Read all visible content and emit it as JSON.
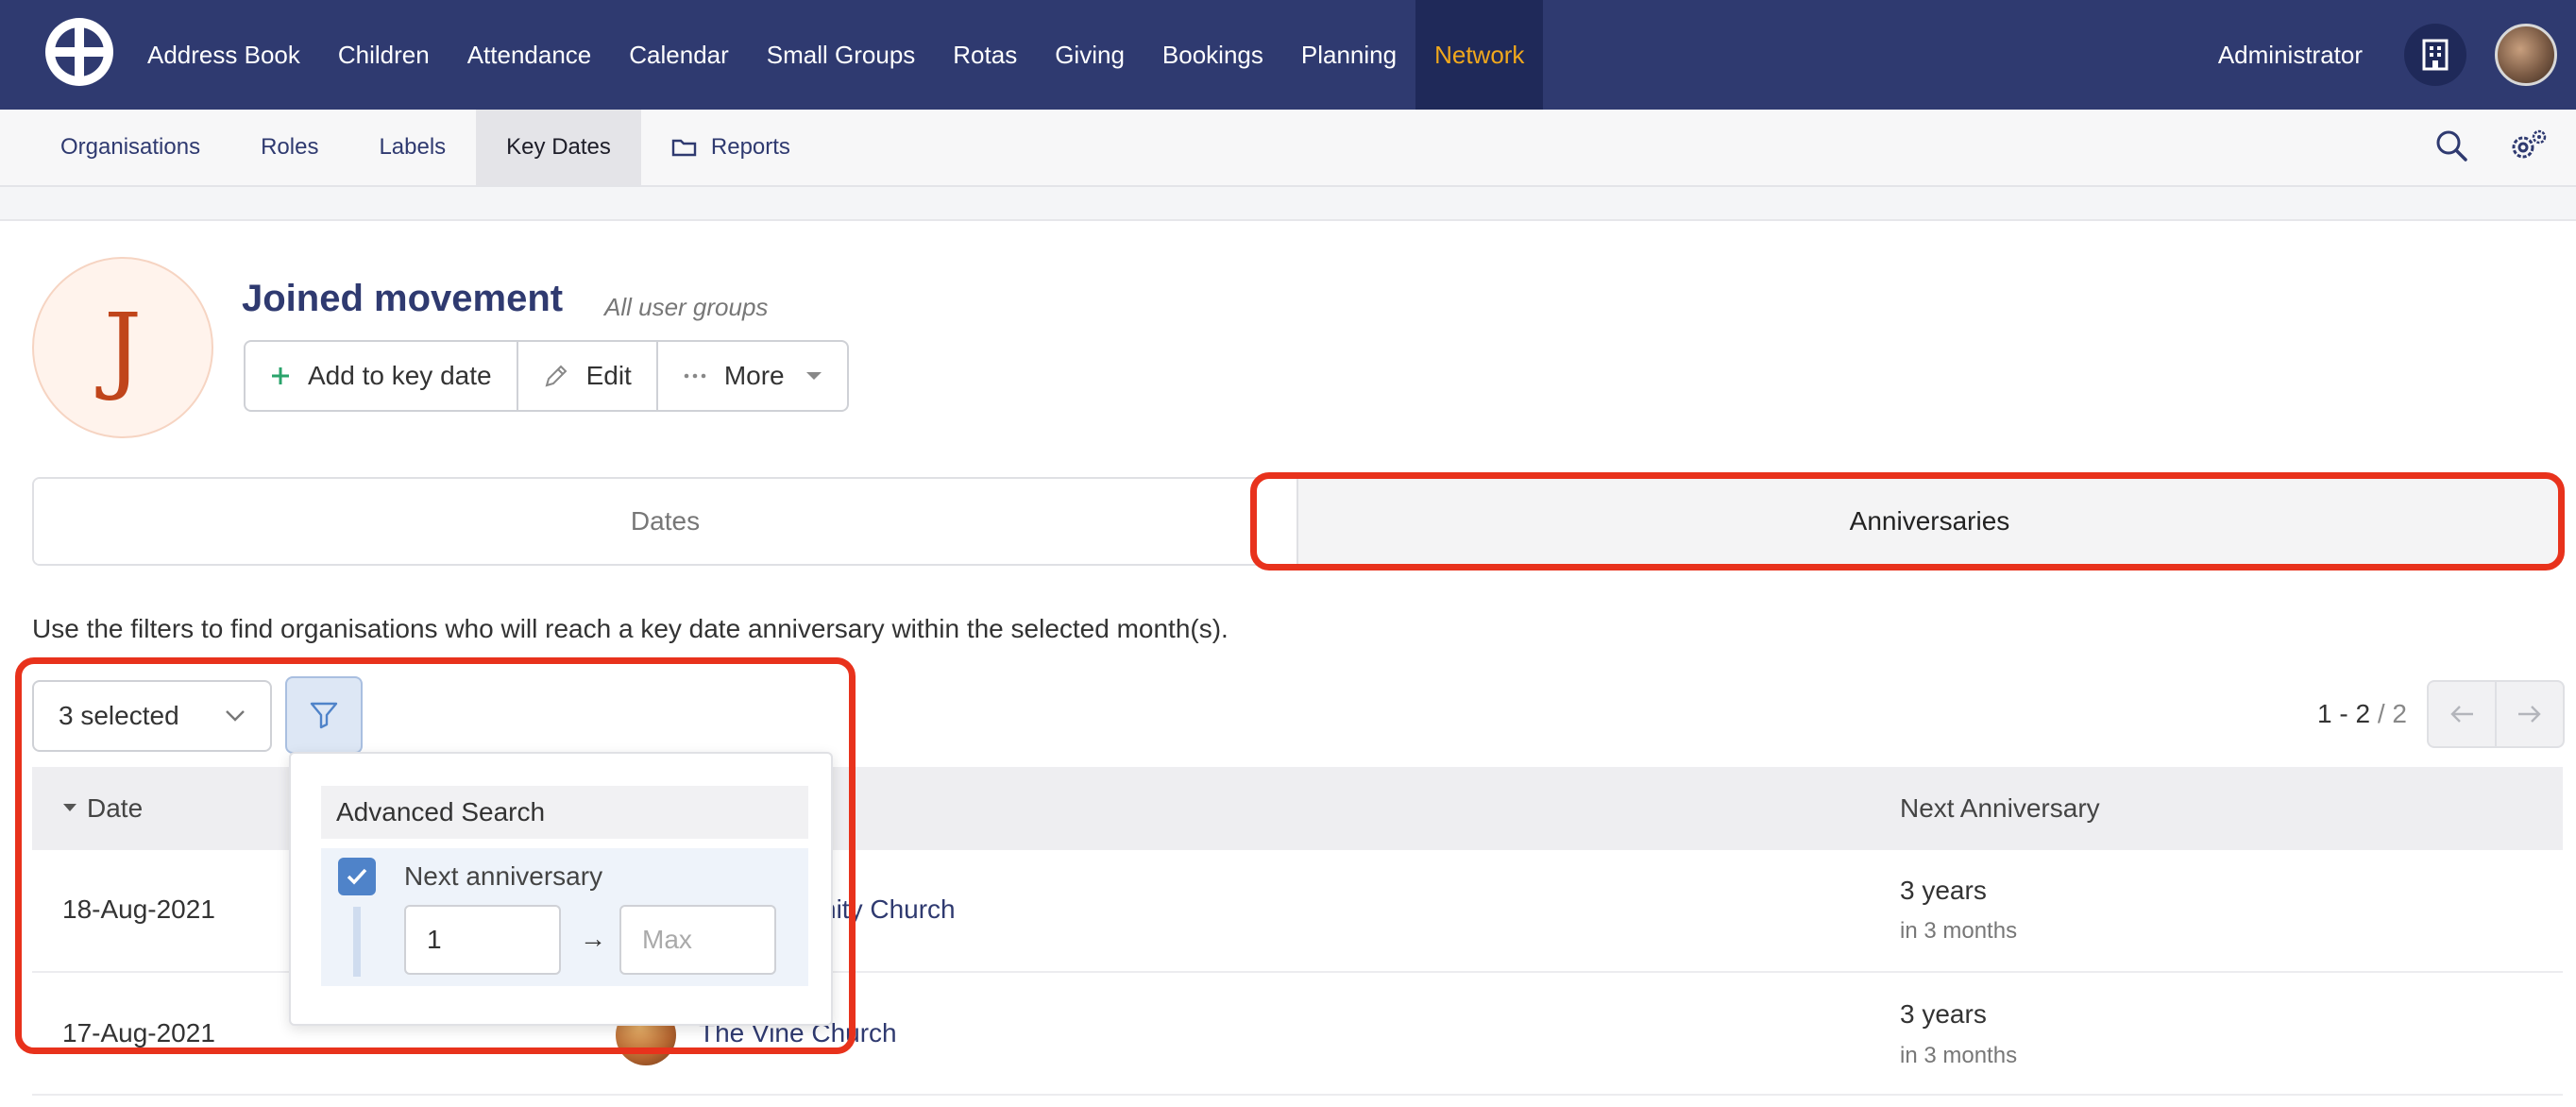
{
  "topnav": {
    "items": [
      "Address Book",
      "Children",
      "Attendance",
      "Calendar",
      "Small Groups",
      "Rotas",
      "Giving",
      "Bookings",
      "Planning",
      "Network"
    ],
    "active": "Network",
    "user_label": "Administrator"
  },
  "subnav": {
    "items": [
      "Organisations",
      "Roles",
      "Labels",
      "Key Dates",
      "Reports"
    ],
    "active": "Key Dates"
  },
  "keydate": {
    "avatar_letter": "J",
    "title": "Joined movement",
    "subtitle": "All user groups",
    "buttons": {
      "add": "Add to key date",
      "edit": "Edit",
      "more": "More"
    }
  },
  "tabs": {
    "dates": "Dates",
    "anniversaries": "Anniversaries",
    "active": "Anniversaries"
  },
  "hint": "Use the filters to find organisations who will reach a key date anniversary within the selected month(s).",
  "filter": {
    "select_value": "3 selected"
  },
  "pager": {
    "range": "1 - 2",
    "total": "/ 2"
  },
  "table": {
    "headers": {
      "date": "Date",
      "next": "Next Anniversary"
    },
    "rows": [
      {
        "date": "18-Aug-2021",
        "name": "Community Church",
        "years": "3 years",
        "when": "in 3 months"
      },
      {
        "date": "17-Aug-2021",
        "name": "The Vine Church",
        "years": "3 years",
        "when": "in 3 months"
      }
    ]
  },
  "advanced_search": {
    "title": "Advanced Search",
    "checkbox_label": "Next anniversary",
    "checked": true,
    "min_value": "1",
    "max_placeholder": "Max",
    "arrow": "→"
  },
  "colors": {
    "nav_bg": "#2f3a70",
    "active_nav_text": "#f1a81c",
    "highlight": "#e8321c",
    "link": "#2f3a70"
  }
}
